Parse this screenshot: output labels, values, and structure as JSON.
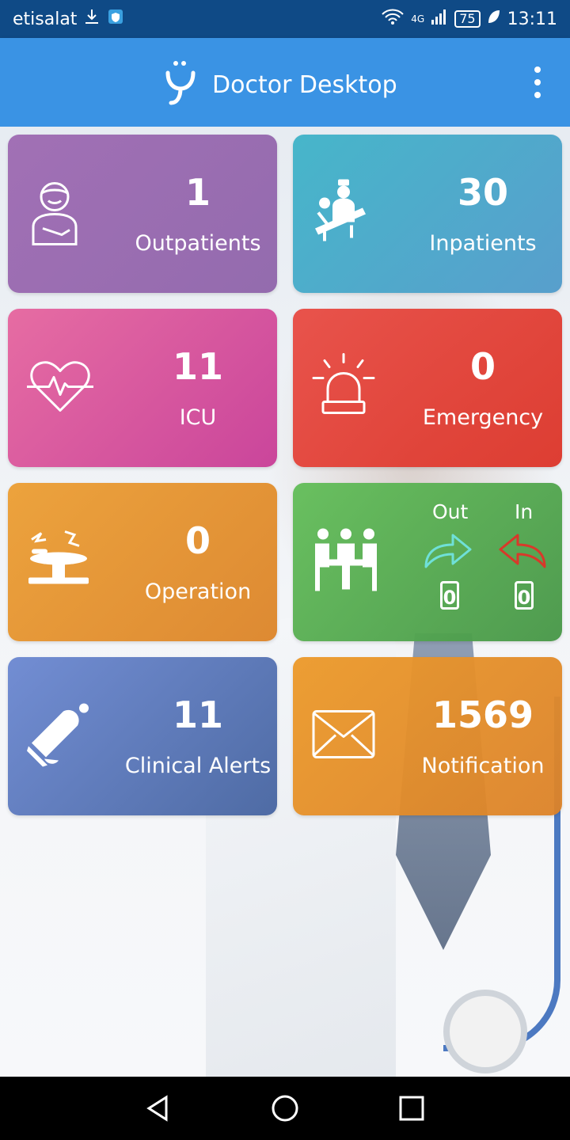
{
  "status_bar": {
    "carrier": "etisalat",
    "network": "4G",
    "battery": "75",
    "time": "13:11"
  },
  "app_bar": {
    "title": "Doctor Desktop"
  },
  "tiles": {
    "outpatients": {
      "count": "1",
      "label": "Outpatients",
      "icon": "outpatient-icon",
      "color": "#9b6bb5"
    },
    "inpatients": {
      "count": "30",
      "label": "Inpatients",
      "icon": "inpatient-icon",
      "color": "#45a8c8"
    },
    "icu": {
      "count": "11",
      "label": "ICU",
      "icon": "heart-pulse-icon",
      "color": "#dc5aa0"
    },
    "emergency": {
      "count": "0",
      "label": "Emergency",
      "icon": "siren-icon",
      "color": "#e04538"
    },
    "operation": {
      "count": "0",
      "label": "Operation",
      "icon": "operating-table-icon",
      "color": "#e29236"
    },
    "meetings": {
      "out_label": "Out",
      "in_label": "In",
      "out_count": "0",
      "in_count": "0",
      "icon": "meeting-icon",
      "color": "#5cb455",
      "out_arrow_color": "#6fe0d8",
      "in_arrow_color": "#d8392a"
    },
    "clinical_alerts": {
      "count": "11",
      "label": "Clinical Alerts",
      "icon": "bell-icon",
      "color": "#5f7ec4"
    },
    "notification": {
      "count": "1569",
      "label": "Notification",
      "icon": "envelope-icon",
      "color": "#e5922f"
    }
  },
  "nav_bar": {
    "back": "back-icon",
    "home": "home-icon",
    "recents": "recents-icon"
  }
}
